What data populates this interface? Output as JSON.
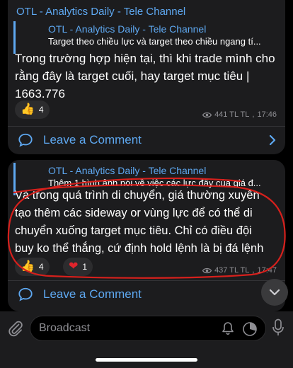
{
  "messages": [
    {
      "channel_name": "OTL - Analytics Daily - Tele Channel",
      "reply": {
        "title": "OTL - Analytics Daily - Tele Channel",
        "text": "Target theo chiều lực và target theo chiều ngang tí..."
      },
      "body_lines": [
        "Trong trường hợp hiện tại, thì khi trade mình cho",
        "rằng đây là target cuối, hay target mục tiêu |",
        "1663.776"
      ],
      "reactions": [
        {
          "emoji": "👍",
          "count": "4"
        }
      ],
      "views": "441 TL TL",
      "time": "17:46",
      "comment_label": "Leave a Comment"
    },
    {
      "reply": {
        "title": "OTL - Analytics Daily - Tele Channel",
        "text": "Thêm 1 hình ảnh nói về việc các lực đẩy của giá đ..."
      },
      "body_lines": [
        "Và trong quá trình di chuyển, giá thường xuyên",
        "tạo thêm các sideway or vùng lực để có thể di",
        "chuyển xuống target mục tiêu. Chỉ có điều đội",
        "buy ko thể thắng, cứ định hold lệnh là bị đá lệnh"
      ],
      "reactions": [
        {
          "emoji": "👍",
          "count": "4"
        },
        {
          "emoji": "❤",
          "count": "1"
        }
      ],
      "views": "437 TL TL",
      "time": "17:47",
      "comment_label": "Leave a Comment"
    }
  ],
  "input": {
    "placeholder": "Broadcast"
  },
  "colors": {
    "accent": "#5ea8f1",
    "annotation": "#d6201c",
    "bubble": "#1c1c1e"
  }
}
